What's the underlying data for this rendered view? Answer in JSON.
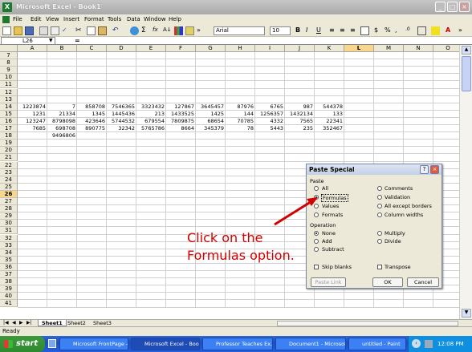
{
  "window": {
    "title": "Microsoft Excel - Book1",
    "app_icon": "X"
  },
  "menu": [
    "File",
    "Edit",
    "View",
    "Insert",
    "Format",
    "Tools",
    "Data",
    "Window",
    "Help"
  ],
  "toolbar": {
    "font": "Arial",
    "size": "10",
    "bold": "B",
    "italic": "I",
    "underline": "U",
    "percent": "%"
  },
  "namebox": "L26",
  "formula_symbol": "=",
  "columns": [
    "A",
    "B",
    "C",
    "D",
    "E",
    "F",
    "G",
    "H",
    "I",
    "J",
    "K",
    "L",
    "M",
    "N",
    "O"
  ],
  "rows": [
    "7",
    "8",
    "9",
    "10",
    "11",
    "12",
    "13",
    "14",
    "15",
    "16",
    "17",
    "18",
    "19",
    "20",
    "21",
    "22",
    "23",
    "24",
    "25",
    "26",
    "27",
    "28",
    "29",
    "30",
    "31",
    "32",
    "33",
    "34",
    "35",
    "36",
    "37",
    "38",
    "39",
    "40",
    "41"
  ],
  "cells": [
    {
      "row": "14",
      "values": [
        "1223874",
        "7",
        "858708",
        "7546365",
        "3323432",
        "127867",
        "3645457",
        "87976",
        "6765",
        "987",
        "544378"
      ]
    },
    {
      "row": "15",
      "values": [
        "1231",
        "21334",
        "1345",
        "1445436",
        "213",
        "1433525",
        "1425",
        "144",
        "1256357",
        "1432134",
        "133"
      ]
    },
    {
      "row": "16",
      "values": [
        "123247",
        "8798098",
        "423646",
        "5744532",
        "679554",
        "7809875",
        "68654",
        "70785",
        "4332",
        "7565",
        "22341"
      ]
    },
    {
      "row": "17",
      "values": [
        "7685",
        "698708",
        "890775",
        "32342",
        "5765786",
        "8664",
        "345379",
        "78",
        "5443",
        "235",
        "352467"
      ]
    },
    {
      "row": "18",
      "values": [
        "",
        "9496806",
        "",
        "",
        "",
        "",
        "",
        "",
        "",
        "",
        ""
      ]
    }
  ],
  "sheets": [
    "Sheet1",
    "Sheet2",
    "Sheet3"
  ],
  "status": "Ready",
  "dialog": {
    "title": "Paste Special",
    "paste_label": "Paste",
    "paste_options": [
      "All",
      "Formulas",
      "Values",
      "Formats",
      "Comments",
      "Validation",
      "All except borders",
      "Column widths"
    ],
    "selected_paste": "Formulas",
    "operation_label": "Operation",
    "operation_options": [
      "None",
      "Add",
      "Subtract",
      "Multiply",
      "Divide"
    ],
    "selected_operation": "None",
    "skip_blanks": "Skip blanks",
    "transpose": "Transpose",
    "paste_link": "Paste Link",
    "ok": "OK",
    "cancel": "Cancel",
    "help_glyph": "?"
  },
  "callout": {
    "line1": "Click on the",
    "line2": "Formulas option."
  },
  "taskbar": {
    "start": "start",
    "tasks": [
      "Microsoft FrontPage -...",
      "Microsoft Excel - Book1",
      "Professor Teaches Ex...",
      "Document1 - Microsof...",
      "untitled - Paint"
    ],
    "clock": "12:08 PM"
  },
  "colors": {
    "callout_red": "#d20000",
    "taskbar_blue": "#245edb",
    "start_green": "#2e8a2e"
  }
}
